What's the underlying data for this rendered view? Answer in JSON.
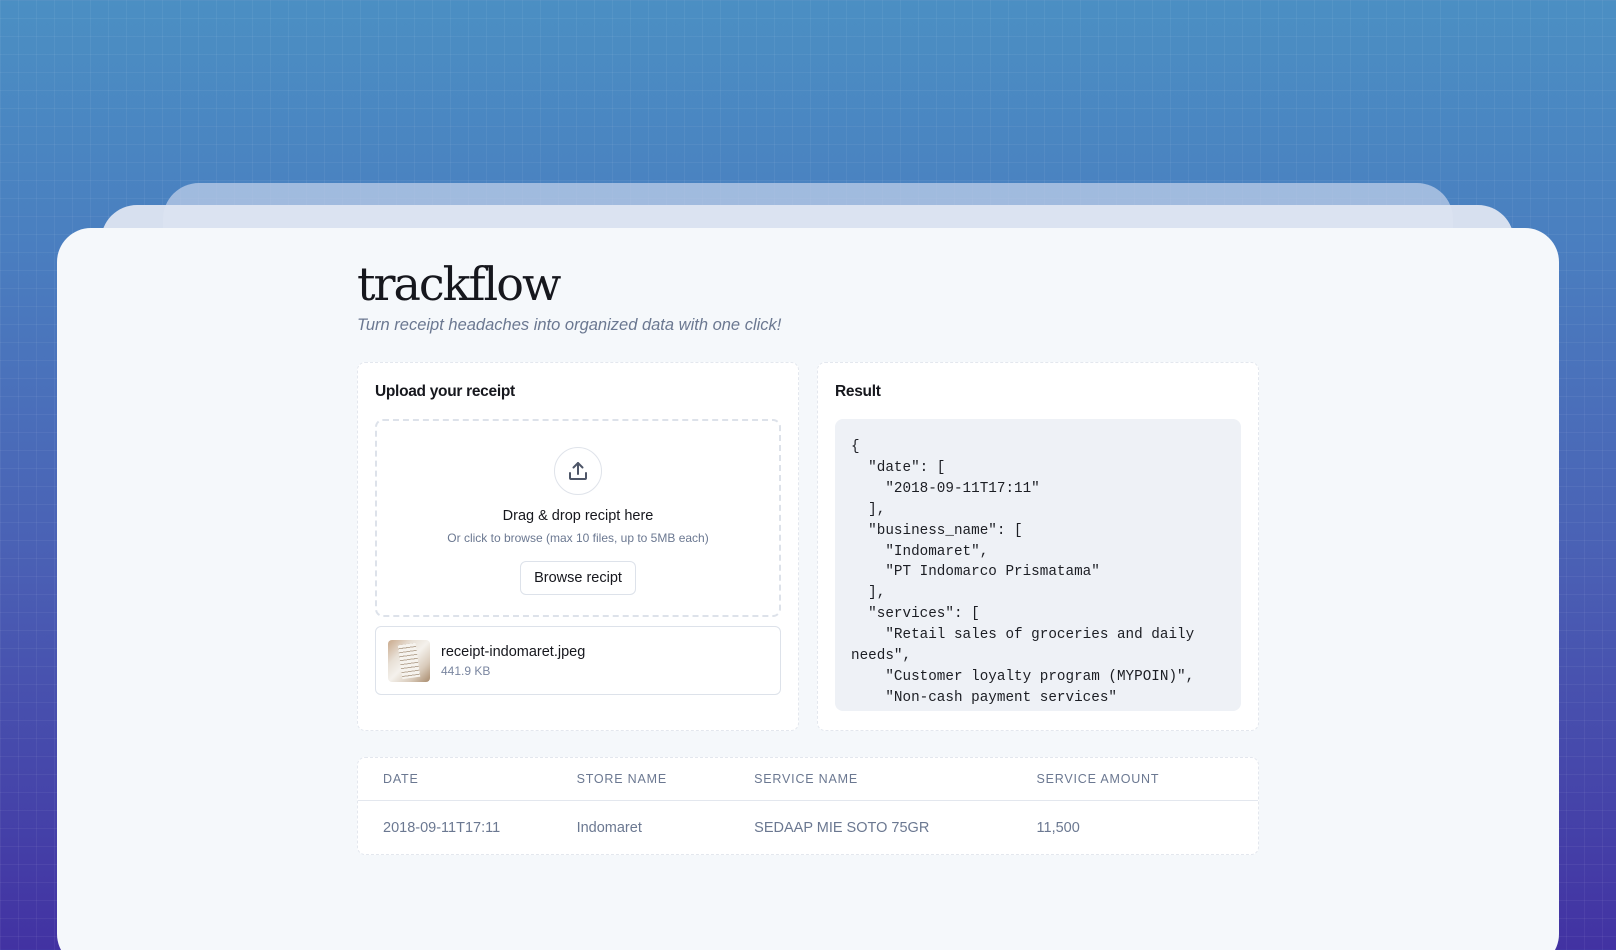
{
  "app": {
    "brand": "trackflow",
    "tagline": "Turn receipt headaches into organized data with one click!"
  },
  "upload_panel": {
    "title": "Upload your receipt",
    "drop_title": "Drag & drop recipt here",
    "drop_sub": "Or click to browse (max 10 files, up to 5MB each)",
    "browse_label": "Browse recipt",
    "icon": "upload-icon",
    "file": {
      "name": "receipt-indomaret.jpeg",
      "size": "441.9 KB"
    }
  },
  "result_panel": {
    "title": "Result",
    "json_text": "{\n  \"date\": [\n    \"2018-09-11T17:11\"\n  ],\n  \"business_name\": [\n    \"Indomaret\",\n    \"PT Indomarco Prismatama\"\n  ],\n  \"services\": [\n    \"Retail sales of groceries and daily needs\",\n    \"Customer loyalty program (MYPOIN)\",\n    \"Non-cash payment services\""
  },
  "table": {
    "headers": [
      "Date",
      "Store Name",
      "Service Name",
      "Service Amount"
    ],
    "rows": [
      [
        "2018-09-11T17:11",
        "Indomaret",
        "SEDAAP MIE SOTO 75GR",
        "11,500"
      ]
    ]
  },
  "colors": {
    "bg_top": "#4b8fc3",
    "bg_bottom": "#4232a2",
    "card": "#f5f8fb",
    "text_primary": "#16171d",
    "text_muted": "#6b7891"
  }
}
